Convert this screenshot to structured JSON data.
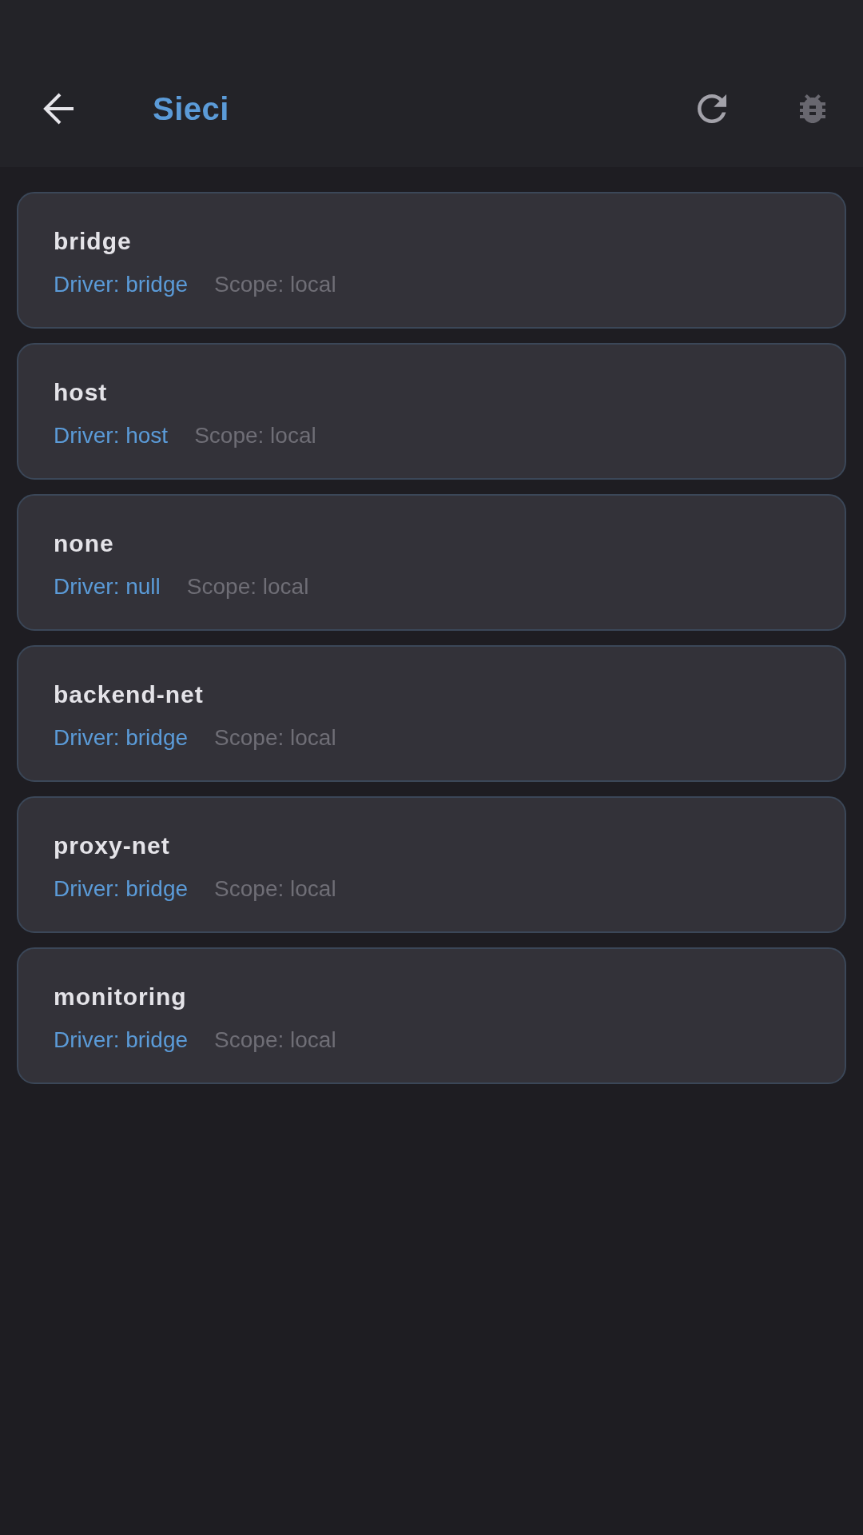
{
  "app_bar": {
    "title": "Sieci"
  },
  "networks": [
    {
      "name": "bridge",
      "driver": "Driver: bridge",
      "scope": "Scope: local"
    },
    {
      "name": "host",
      "driver": "Driver: host",
      "scope": "Scope: local"
    },
    {
      "name": "none",
      "driver": "Driver: null",
      "scope": "Scope: local"
    },
    {
      "name": "backend-net",
      "driver": "Driver: bridge",
      "scope": "Scope: local"
    },
    {
      "name": "proxy-net",
      "driver": "Driver: bridge",
      "scope": "Scope: local"
    },
    {
      "name": "monitoring",
      "driver": "Driver: bridge",
      "scope": "Scope: local"
    }
  ]
}
